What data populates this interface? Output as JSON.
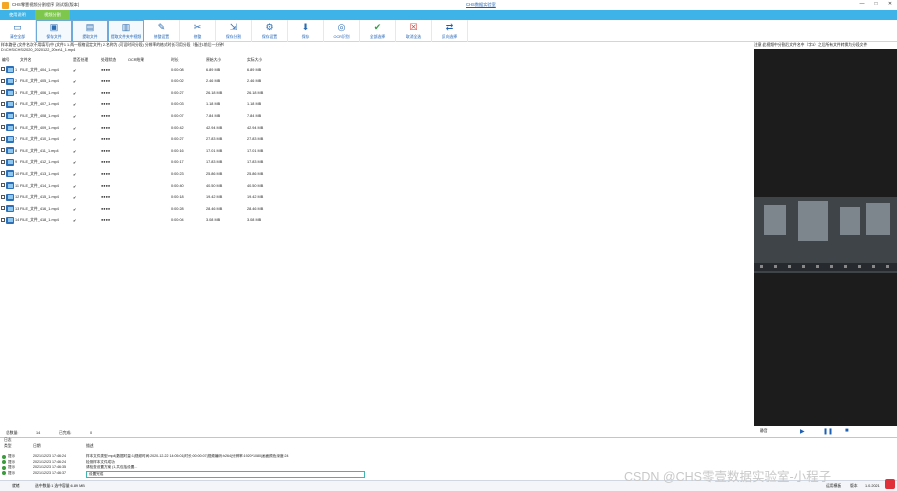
{
  "window": {
    "title": "CHS零壹视频分割程序 测试版(版本)",
    "link": "CHS数据实验室",
    "controls": [
      "—",
      "□",
      "✕"
    ]
  },
  "tabs": [
    {
      "label": "使用说明",
      "active": false
    },
    {
      "label": "视频分割",
      "active": true
    }
  ],
  "ribbon": [
    {
      "label": "清空全部",
      "icon": "eraser-icon"
    },
    {
      "label": "保存文件",
      "icon": "floppy-icon"
    },
    {
      "label": "提取文件",
      "icon": "file-icon"
    },
    {
      "label": "提取文件夹中视频",
      "icon": "folder-icon"
    },
    {
      "label": "修整设置",
      "icon": "tool-icon"
    },
    {
      "label": "修整",
      "icon": "scissors-icon"
    },
    {
      "label": "保存分割",
      "icon": "save-split-icon"
    },
    {
      "label": "保存设置",
      "icon": "settings-icon"
    },
    {
      "label": "保存",
      "icon": "save-icon"
    },
    {
      "label": "OCR识别",
      "icon": "ocr-icon"
    },
    {
      "label": "全部选择",
      "icon": "check-icon"
    },
    {
      "label": "取消全选",
      "icon": "uncheck-icon"
    },
    {
      "label": "反向选择",
      "icon": "invert-icon"
    }
  ],
  "info": {
    "line1": "样本路径 (文件名次不用填写)中 (文件1 1.两一规格设定文件) 2.名称为 (可设时间分段) 分辨率的格式时长可用分段（备注1前后一分钟）",
    "line2": "D:\\CHS\\CHS\\2020_2020122_20xx\\1_1.mp4",
    "preview_note": "注意:此视频中分割后文件名中（字3）之后所有文件转换为分段文件"
  },
  "table": {
    "headers": [
      "编号",
      "文件名",
      "是否处理",
      "处理状态",
      "OCR结果",
      "时长",
      "原始大小",
      "实际大小"
    ],
    "rows": [
      {
        "no": "1",
        "name": "FILE_文件_404_1.mp4",
        "done": "✔",
        "status": "●●●●",
        "ocr": "",
        "dur": "0:00:08",
        "orig": "6.89 MB",
        "real": "6.89 MB"
      },
      {
        "no": "2",
        "name": "FILE_文件_405_1.mp4",
        "done": "✔",
        "status": "●●●●",
        "ocr": "",
        "dur": "0:00:02",
        "orig": "2.46 MB",
        "real": "2.46 MB"
      },
      {
        "no": "3",
        "name": "FILE_文件_406_1.mp4",
        "done": "✔",
        "status": "●●●●",
        "ocr": "",
        "dur": "0:00:27",
        "orig": "26.18 MB",
        "real": "26.18 MB"
      },
      {
        "no": "4",
        "name": "FILE_文件_407_1.mp4",
        "done": "✔",
        "status": "●●●●",
        "ocr": "",
        "dur": "0:00:03",
        "orig": "1.18 MB",
        "real": "1.18 MB"
      },
      {
        "no": "5",
        "name": "FILE_文件_408_1.mp4",
        "done": "✔",
        "status": "●●●●",
        "ocr": "",
        "dur": "0:00:07",
        "orig": "7.84 MB",
        "real": "7.84 MB"
      },
      {
        "no": "6",
        "name": "FILE_文件_409_1.mp4",
        "done": "✔",
        "status": "●●●●",
        "ocr": "",
        "dur": "0:00:42",
        "orig": "42.94 MB",
        "real": "42.94 MB"
      },
      {
        "no": "7",
        "name": "FILE_文件_410_1.mp4",
        "done": "✔",
        "status": "●●●●",
        "ocr": "",
        "dur": "0:00:27",
        "orig": "27.83 MB",
        "real": "27.83 MB"
      },
      {
        "no": "8",
        "name": "FILE_文件_411_1.mp4",
        "done": "✔",
        "status": "●●●●",
        "ocr": "",
        "dur": "0:00:16",
        "orig": "17.01 MB",
        "real": "17.01 MB"
      },
      {
        "no": "9",
        "name": "FILE_文件_412_1.mp4",
        "done": "✔",
        "status": "●●●●",
        "ocr": "",
        "dur": "0:00:17",
        "orig": "17.83 MB",
        "real": "17.83 MB"
      },
      {
        "no": "10",
        "name": "FILE_文件_413_1.mp4",
        "done": "✔",
        "status": "●●●●",
        "ocr": "",
        "dur": "0:00:23",
        "orig": "25.86 MB",
        "real": "25.86 MB"
      },
      {
        "no": "11",
        "name": "FILE_文件_414_1.mp4",
        "done": "✔",
        "status": "●●●●",
        "ocr": "",
        "dur": "0:00:40",
        "orig": "40.50 MB",
        "real": "40.50 MB"
      },
      {
        "no": "12",
        "name": "FILE_文件_415_1.mp4",
        "done": "✔",
        "status": "●●●●",
        "ocr": "",
        "dur": "0:00:18",
        "orig": "19.42 MB",
        "real": "19.42 MB"
      },
      {
        "no": "13",
        "name": "FILE_文件_416_1.mp4",
        "done": "✔",
        "status": "●●●●",
        "ocr": "",
        "dur": "0:00:28",
        "orig": "28.46 MB",
        "real": "28.46 MB"
      },
      {
        "no": "14",
        "name": "FILE_文件_418_1.mp4",
        "done": "✔",
        "status": "●●●●",
        "ocr": "",
        "dur": "0:00:04",
        "orig": "3.08 MB",
        "real": "3.08 MB"
      }
    ]
  },
  "stats": {
    "total_label": "总数量:",
    "total": "14",
    "done_label": "已完成:",
    "done": "0"
  },
  "player": {
    "label": "静音",
    "play": "▶",
    "pause": "❚❚",
    "stop": "■"
  },
  "log": {
    "title": "日志",
    "headers": [
      "类型",
      "日期",
      "描述"
    ],
    "rows": [
      {
        "type": "提示",
        "date": "2021/12/23 17:46:24",
        "msg": "样本文件类型:mp4|数据时量:1|视频时间:2020-12-22 14:05:01|时长:00:00:07|视频编码:h264|分辨率:1920*1080|画面颜色深度:24"
      },
      {
        "type": "提示",
        "date": "2021/12/23 17:46:24",
        "msg": "检测样本文件成功"
      },
      {
        "type": "提示",
        "date": "2021/12/23 17:46:35",
        "msg": "请检查设置方案 (1,共包括设置..."
      },
      {
        "type": "提示",
        "date": "2021/12/23 17:46:37",
        "msg": "设置完成"
      }
    ]
  },
  "statusbar": {
    "left": "就绪",
    "mid": "选中数量:1 选中容量:6.89 MB",
    "right1": "运用模板",
    "right2": "版本",
    "right3": "1.0.2021"
  },
  "watermark": "CSDN @CHS零壹数据实验室-小程子"
}
